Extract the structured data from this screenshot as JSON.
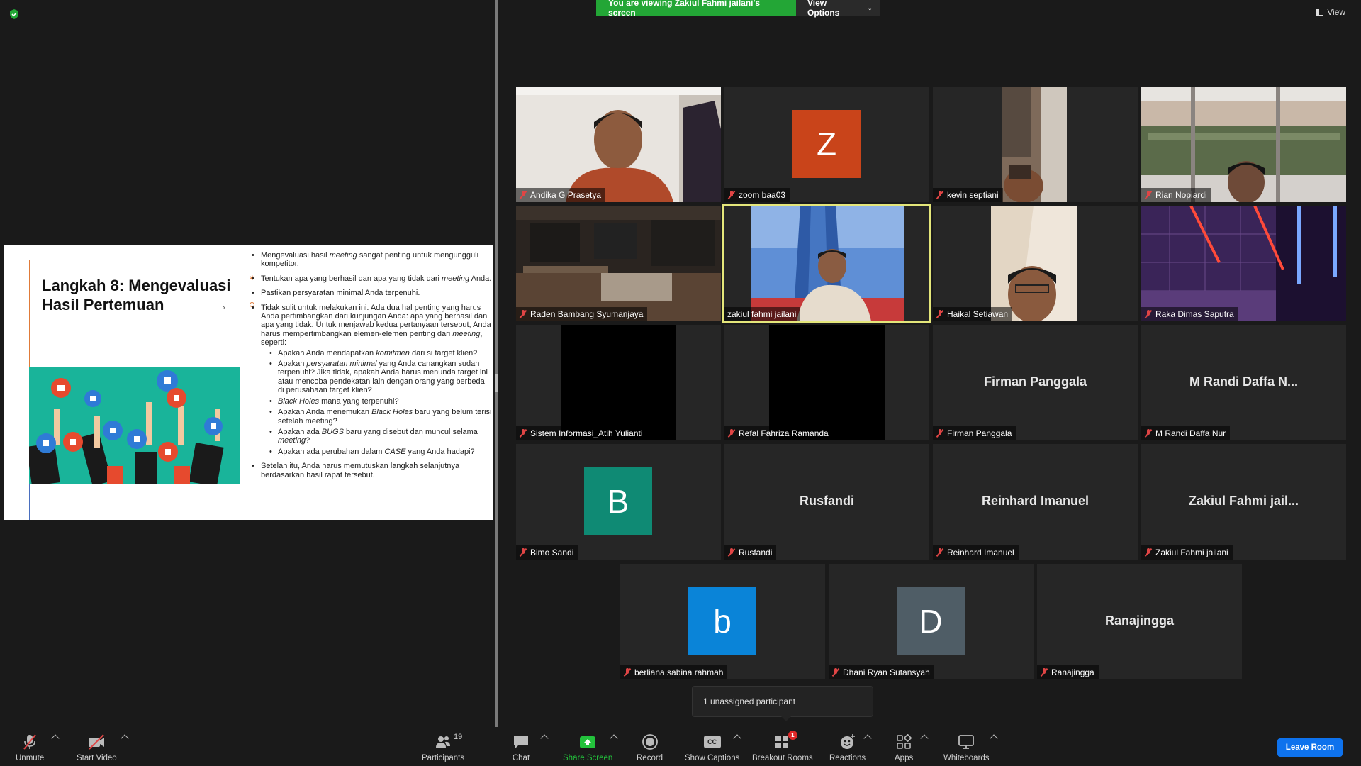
{
  "banner": {
    "message": "You are viewing Zakiul Fahmi jailani's screen",
    "options_label": "View Options"
  },
  "view_label": "View",
  "slide": {
    "title": "Langkah 8:  Mengevaluasi Hasil Pertemuan",
    "bullets": {
      "b1_pre": "Mengevaluasi hasil ",
      "b1_em": "meeting",
      "b1_post": " sangat penting untuk mengungguli kompetitor.",
      "b2_pre": "Tentukan apa yang berhasil dan apa yang tidak dari ",
      "b2_em": "meeting",
      "b2_post": " Anda.",
      "b3": "Pastikan persyaratan minimal Anda terpenuhi.",
      "b4_pre": "Tidak sulit untuk melakukan ini. Ada dua hal penting yang harus Anda pertimbangkan dari kunjungan Anda: apa yang berhasil dan apa yang tidak. Untuk menjawab kedua pertanyaan tersebut, Anda harus mempertimbangkan elemen-elemen penting dari ",
      "b4_em": "meeting",
      "b4_post": ", seperti:",
      "s1_pre": "Apakah Anda mendapatkan ",
      "s1_em": "komitmen",
      "s1_post": " dari si target klien?",
      "s2_pre": "Apakah ",
      "s2_em": "persyaratan minimal",
      "s2_post": " yang Anda canangkan sudah terpenuhi? Jika tidak, apakah Anda harus menunda target ini atau mencoba pendekatan lain dengan orang yang berbeda di perusahaan target klien?",
      "s3_em": "Black Holes",
      "s3_post": " mana yang terpenuhi?",
      "s4_pre": "Apakah Anda menemukan ",
      "s4_em": "Black Holes",
      "s4_post": " baru yang belum terisi setelah meeting?",
      "s5_pre": "Apakah ada ",
      "s5_em": "BUGS",
      "s5_mid": " baru yang disebut dan muncul selama ",
      "s5_em2": "meeting",
      "s5_post": "?",
      "s6_pre": "Apakah ada perubahan dalam ",
      "s6_em": "CASE",
      "s6_post": " yang Anda hadapi?",
      "b5": "Setelah itu, Anda harus memutuskan langkah selanjutnya berdasarkan hasil rapat tersebut."
    }
  },
  "participants": [
    {
      "name": "Andika G Prasetya"
    },
    {
      "name": "zoom baa03",
      "avatar": "Z",
      "color": "#c9441a"
    },
    {
      "name": "kevin septiani"
    },
    {
      "name": "Rian Nopiardi"
    },
    {
      "name": "Raden Bambang Syumanjaya"
    },
    {
      "name": "zakiul fahmi jailani"
    },
    {
      "name": "Haikal Setiawan"
    },
    {
      "name": "Raka Dimas Saputra"
    },
    {
      "name": "Sistem Informasi_Atih Yulianti"
    },
    {
      "name": "Refal Fahriza Ramanda"
    },
    {
      "name": "Firman Panggala",
      "display": "Firman Panggala"
    },
    {
      "name": "M Randi Daffa Nur",
      "display": "M Randi Daffa N..."
    },
    {
      "name": "Bimo Sandi",
      "avatar": "B",
      "color": "#0f8a74"
    },
    {
      "name": "Rusfandi",
      "display": "Rusfandi"
    },
    {
      "name": "Reinhard Imanuel",
      "display": "Reinhard Imanuel"
    },
    {
      "name": "Zakiul Fahmi jailani",
      "display": "Zakiul  Fahmi  jail..."
    },
    {
      "name": "berliana sabina rahmah",
      "avatar": "b",
      "color": "#0a84d8"
    },
    {
      "name": "Dhani Ryan Sutansyah",
      "avatar": "D",
      "color": "#4f5d66"
    },
    {
      "name": "Ranajingga",
      "display": "Ranajingga"
    }
  ],
  "tooltip": "1 unassigned participant",
  "toolbar": {
    "unmute": "Unmute",
    "start_video": "Start Video",
    "participants": "Participants",
    "participants_count": "19",
    "chat": "Chat",
    "share_screen": "Share Screen",
    "record": "Record",
    "show_captions": "Show Captions",
    "breakout_rooms": "Breakout Rooms",
    "breakout_badge": "1",
    "reactions": "Reactions",
    "apps": "Apps",
    "whiteboards": "Whiteboards",
    "leave": "Leave Room",
    "cc": "CC"
  },
  "colors": {
    "banner_green": "#23a636",
    "leave_blue": "#0e72ed",
    "active_outline": "#e4e67a",
    "mic_off_red": "#e04545"
  }
}
